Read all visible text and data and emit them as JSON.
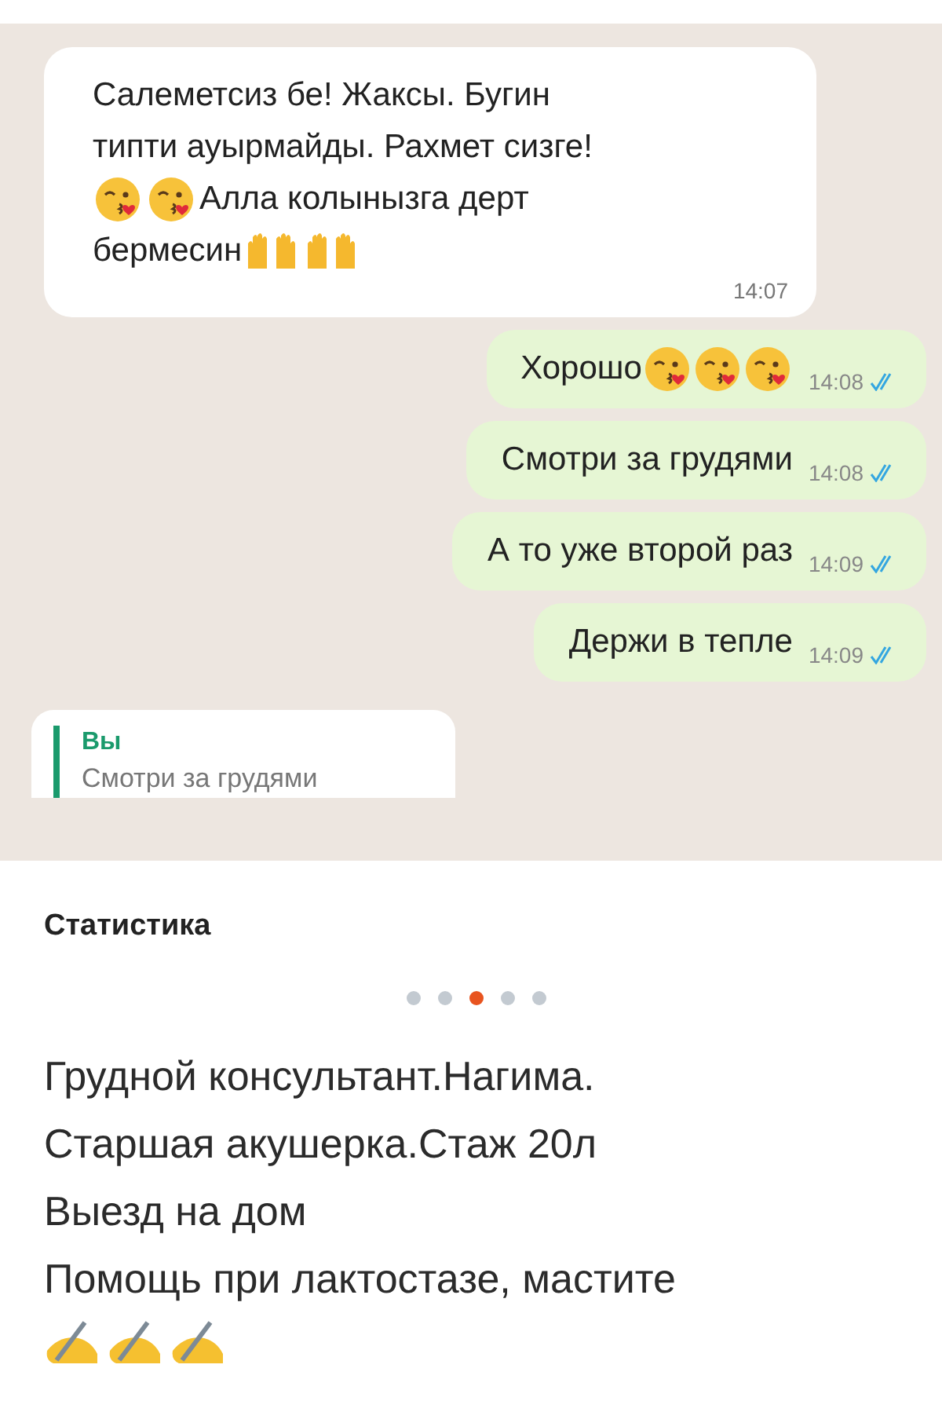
{
  "chat": {
    "messages": [
      {
        "kind": "incoming",
        "lines": [
          [
            {
              "kind": "text",
              "text": "Салеметсиз бе! Жаксы. Бугин"
            }
          ],
          [
            {
              "kind": "text",
              "text": "типти ауырмайды. Рахмет сизге!"
            }
          ],
          [
            {
              "kind": "kiss"
            },
            {
              "kind": "kiss"
            },
            {
              "kind": "text",
              "text": "Алла колынызга дерт"
            }
          ],
          [
            {
              "kind": "text",
              "text": "бермесин"
            },
            {
              "kind": "hands"
            },
            {
              "kind": "hands"
            }
          ]
        ],
        "time": "14:07"
      },
      {
        "kind": "outgoing",
        "lines": [
          [
            {
              "kind": "text",
              "text": "Хорошо"
            },
            {
              "kind": "kiss"
            },
            {
              "kind": "kiss"
            },
            {
              "kind": "kiss"
            }
          ]
        ],
        "time": "14:08",
        "read": true
      },
      {
        "kind": "outgoing",
        "lines": [
          [
            {
              "kind": "text",
              "text": "Смотри за грудями"
            }
          ]
        ],
        "time": "14:08",
        "read": true
      },
      {
        "kind": "outgoing",
        "lines": [
          [
            {
              "kind": "text",
              "text": "А то уже второй раз"
            }
          ]
        ],
        "time": "14:09",
        "read": true
      },
      {
        "kind": "outgoing",
        "lines": [
          [
            {
              "kind": "text",
              "text": "Держи в тепле"
            }
          ]
        ],
        "time": "14:09",
        "read": true
      },
      {
        "kind": "quote",
        "sender": "Вы",
        "text": "Смотри за грудями"
      }
    ]
  },
  "post": {
    "heading": "Статистика",
    "carousel_dots": [
      {
        "selected": false
      },
      {
        "selected": false
      },
      {
        "selected": true
      },
      {
        "selected": false
      },
      {
        "selected": false
      }
    ],
    "lines": [
      "Грудной консультант.Нагима.",
      "Старшая акушерка.Стаж 20л",
      "Выезд на дом",
      "Помощь при лактостазе, мастите"
    ],
    "trailing_emoji": [
      {
        "kind": "writing"
      },
      {
        "kind": "writing"
      },
      {
        "kind": "writing"
      }
    ]
  }
}
